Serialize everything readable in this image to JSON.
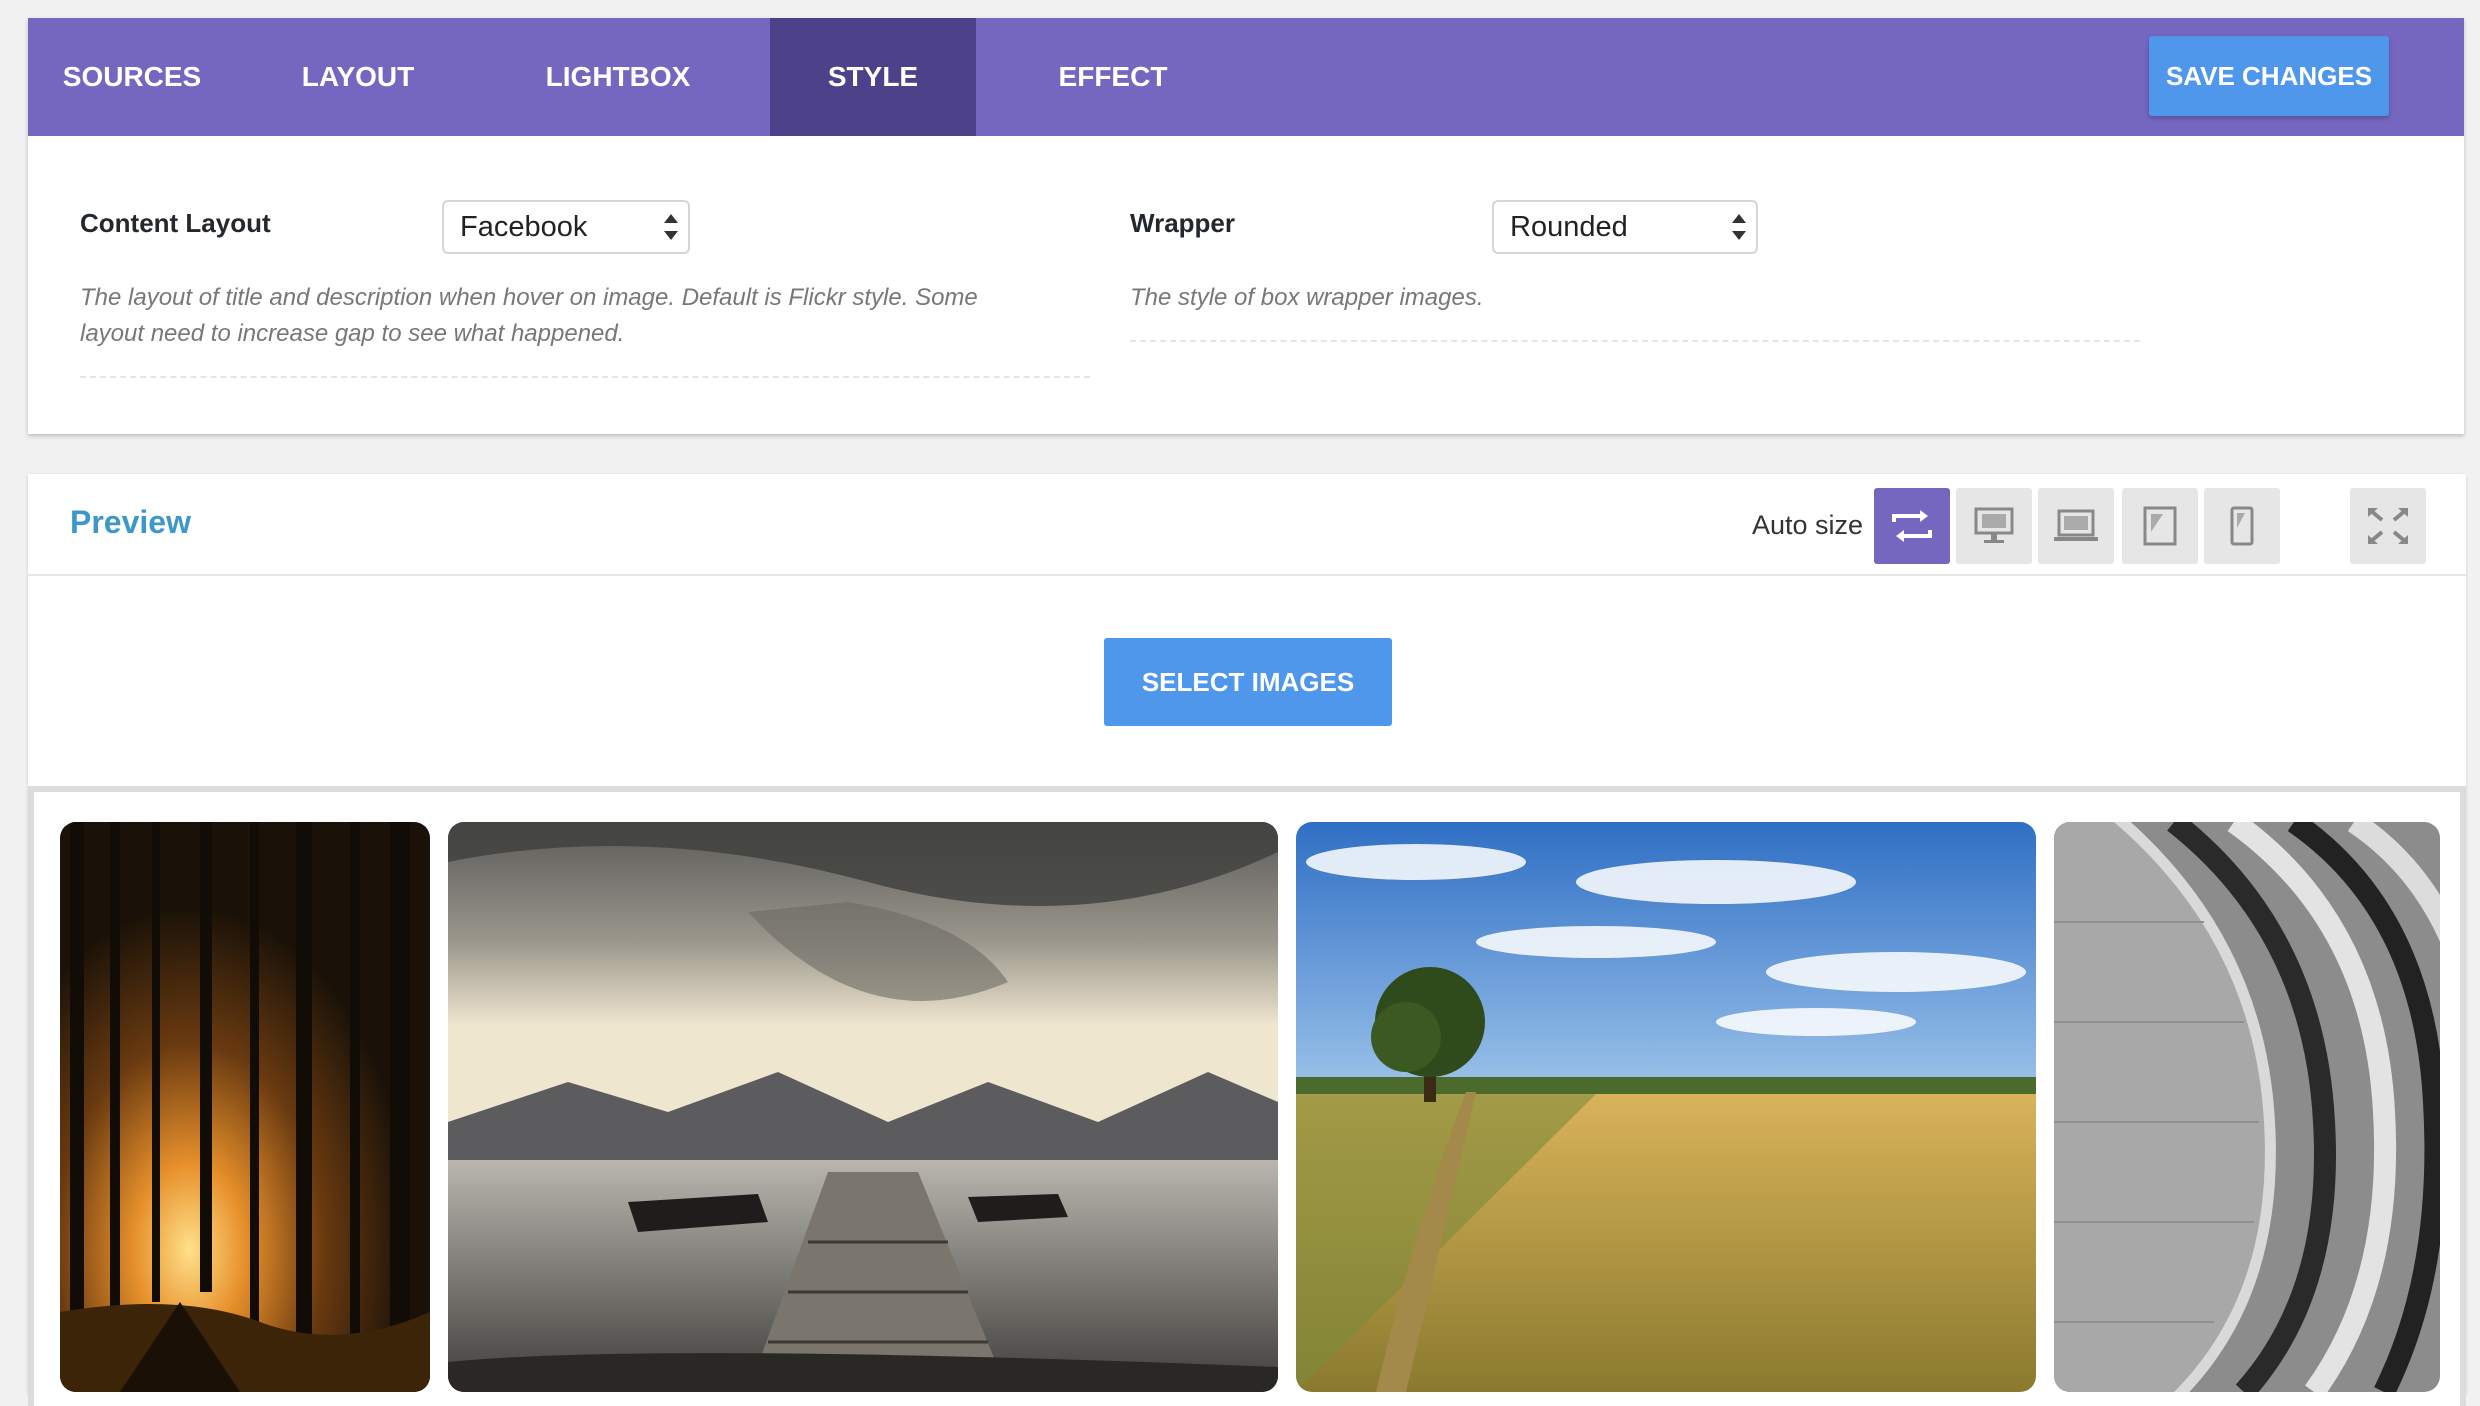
{
  "tabs": [
    {
      "label": "SOURCES",
      "active": false
    },
    {
      "label": "LAYOUT",
      "active": false
    },
    {
      "label": "LIGHTBOX",
      "active": false
    },
    {
      "label": "STYLE",
      "active": true
    },
    {
      "label": "EFFECT",
      "active": false
    }
  ],
  "toolbar": {
    "save_label": "SAVE CHANGES"
  },
  "settings": {
    "content_layout": {
      "label": "Content Layout",
      "value": "Facebook",
      "desc_line1": "The layout of title and description when hover on image. Default is Flickr style. Some",
      "desc_line2": "layout need to increase gap to see what happened."
    },
    "wrapper": {
      "label": "Wrapper",
      "value": "Rounded",
      "desc": "The style of box wrapper images."
    }
  },
  "preview": {
    "title": "Preview",
    "autosize_label": "Auto size",
    "select_images_label": "SELECT IMAGES",
    "device_buttons": [
      {
        "icon": "auto-size-arrows-icon",
        "active": true
      },
      {
        "icon": "desktop-icon",
        "active": false
      },
      {
        "icon": "laptop-icon",
        "active": false
      },
      {
        "icon": "tablet-icon",
        "active": false
      },
      {
        "icon": "phone-icon",
        "active": false
      },
      {
        "icon": "fullscreen-icon",
        "active": false
      }
    ],
    "images": [
      {
        "subject": "forest-at-sunset"
      },
      {
        "subject": "lake-dock-mountains"
      },
      {
        "subject": "field-with-tree"
      },
      {
        "subject": "curved-stairs"
      }
    ]
  },
  "colors": {
    "tabbar": "#7566c0",
    "tab_active": "#4d4289",
    "primary_button": "#4f97ea",
    "preview_title": "#3d97c9"
  }
}
